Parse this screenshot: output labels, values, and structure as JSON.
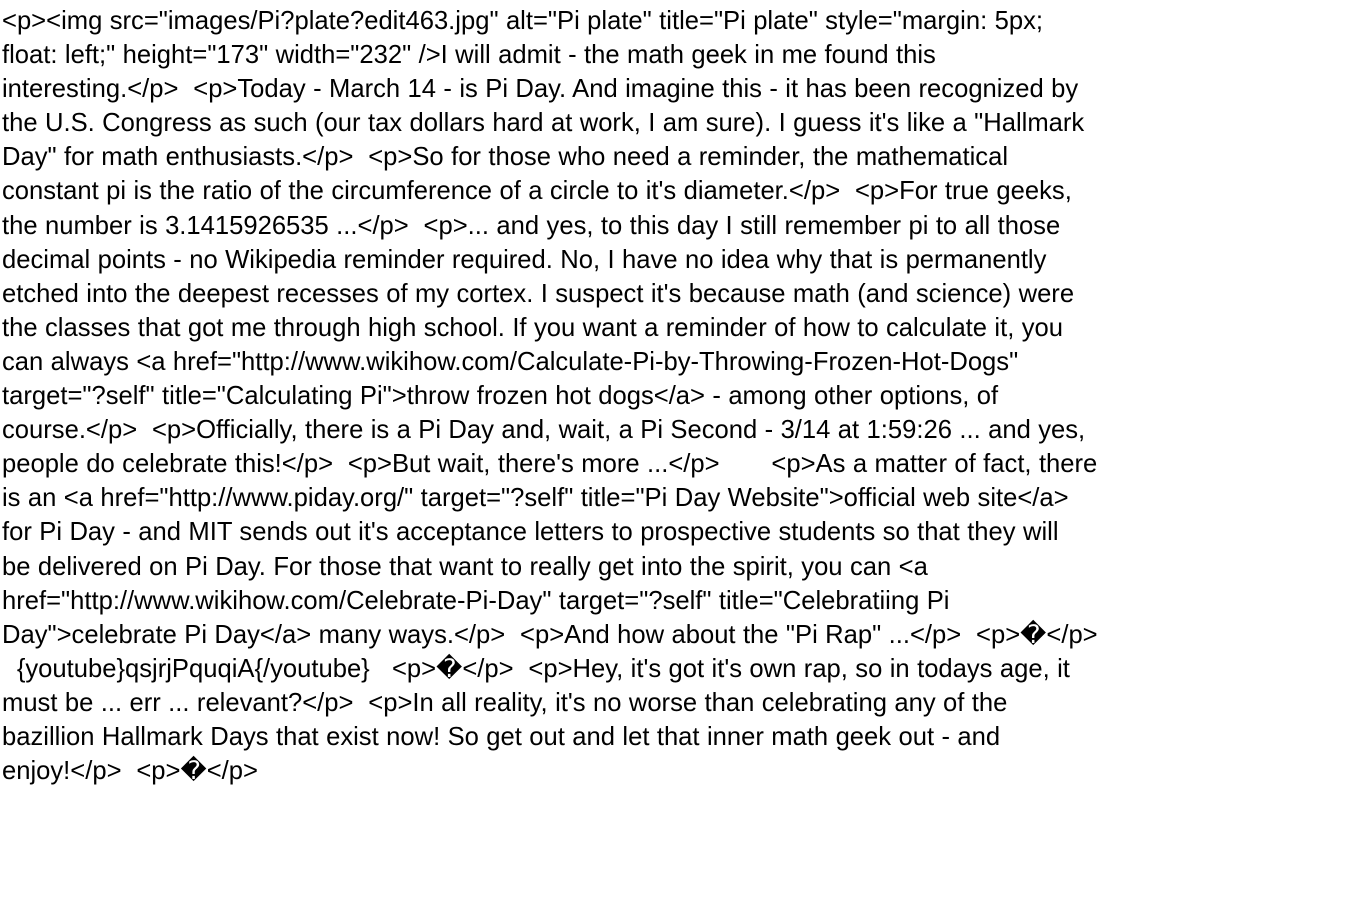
{
  "document": {
    "lines": [
      "<p><img src=\"images/Pi?plate?edit463.jpg\" alt=\"Pi plate\" title=\"Pi plate\" style=\"margin: 5px;",
      "float: left;\" height=\"173\" width=\"232\" />I will admit - the math geek in me found this",
      "interesting.</p>  <p>Today - March 14 - is Pi Day. And imagine this - it has been recognized by",
      "the U.S. Congress as such (our tax dollars hard at work, I am sure). I guess it's like a \"Hallmark",
      "Day\" for math enthusiasts.</p>  <p>So for those who need a reminder, the mathematical",
      "constant pi is the ratio of the circumference of a circle to it's diameter.</p>  <p>For true geeks,",
      "the number is 3.1415926535 ...</p>  <p>... and yes, to this day I still remember pi to all those",
      "decimal points - no Wikipedia reminder required. No, I have no idea why that is permanently",
      "etched into the deepest recesses of my cortex. I suspect it's because math (and science) were",
      "the classes that got me through high school. If you want a reminder of how to calculate it, you",
      "can always <a href=\"http://www.wikihow.com/Calculate-Pi-by-Throwing-Frozen-Hot-Dogs\"",
      "target=\"?self\" title=\"Calculating Pi\">throw frozen hot dogs</a> - among other options, of",
      "course.</p>  <p>Officially, there is a Pi Day and, wait, a Pi Second - 3/14 at 1:59:26 ... and yes,",
      "people do celebrate this!</p>  <p>But wait, there's more ...</p>       <p>As a matter of fact, there",
      "is an <a href=\"http://www.piday.org/\" target=\"?self\" title=\"Pi Day Website\">official web site</a>",
      "for Pi Day - and MIT sends out it's acceptance letters to prospective students so that they will",
      "be delivered on Pi Day. For those that want to really get into the spirit, you can <a",
      "href=\"http://www.wikihow.com/Celebrate-Pi-Day\" target=\"?self\" title=\"Celebratiing Pi",
      "Day\">celebrate Pi Day</a> many ways.</p>  <p>And how about the \"Pi Rap\" ...</p>  <p>�</p>",
      "  {youtube}qsjrjPquqiA{/youtube}   <p>�</p>  <p>Hey, it's got it's own rap, so in todays age, it",
      "must be ... err ... relevant?</p>  <p>In all reality, it's no worse than celebrating any of the",
      "bazillion Hallmark Days that exist now! So get out and let that inner math geek out - and",
      "enjoy!</p>  <p>�</p>"
    ]
  }
}
